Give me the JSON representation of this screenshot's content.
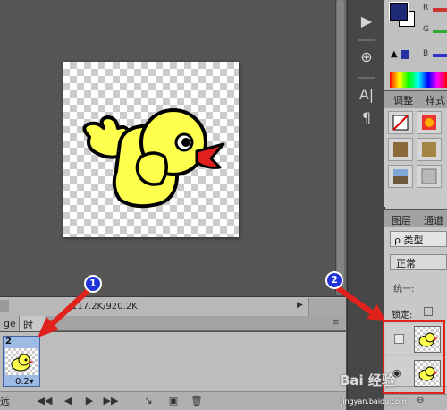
{
  "document": {
    "size_info": "117.2K/920.2K"
  },
  "timeline": {
    "tab_image": "ge",
    "tab_timeline": "时间",
    "frame_number": "2",
    "frame_delay": "0.2▾",
    "loop_label": "远"
  },
  "annotations": {
    "badge_1": "1",
    "badge_2": "2"
  },
  "color_panel": {
    "channel_r": "R",
    "channel_g": "G",
    "channel_b": "B",
    "fg_color": "#1e2a76",
    "bg_color": "#ffffff"
  },
  "adjustments": {
    "tab_adjust": "调整",
    "tab_styles": "样式"
  },
  "layers": {
    "tab_layers": "图层",
    "tab_channels": "通道",
    "kind_filter": "ρ 类型",
    "blend_mode": "正常",
    "unify_label": "统一:",
    "lock_label": "锁定:"
  },
  "watermark": {
    "brand": "Bai 经验",
    "url": "jingyan.baidu.com"
  },
  "colors": {
    "annotation_red": "#e1211c",
    "badge_blue": "#1e34d9",
    "bird_yellow": "#ffff4d",
    "beak_red": "#e11f1f"
  }
}
